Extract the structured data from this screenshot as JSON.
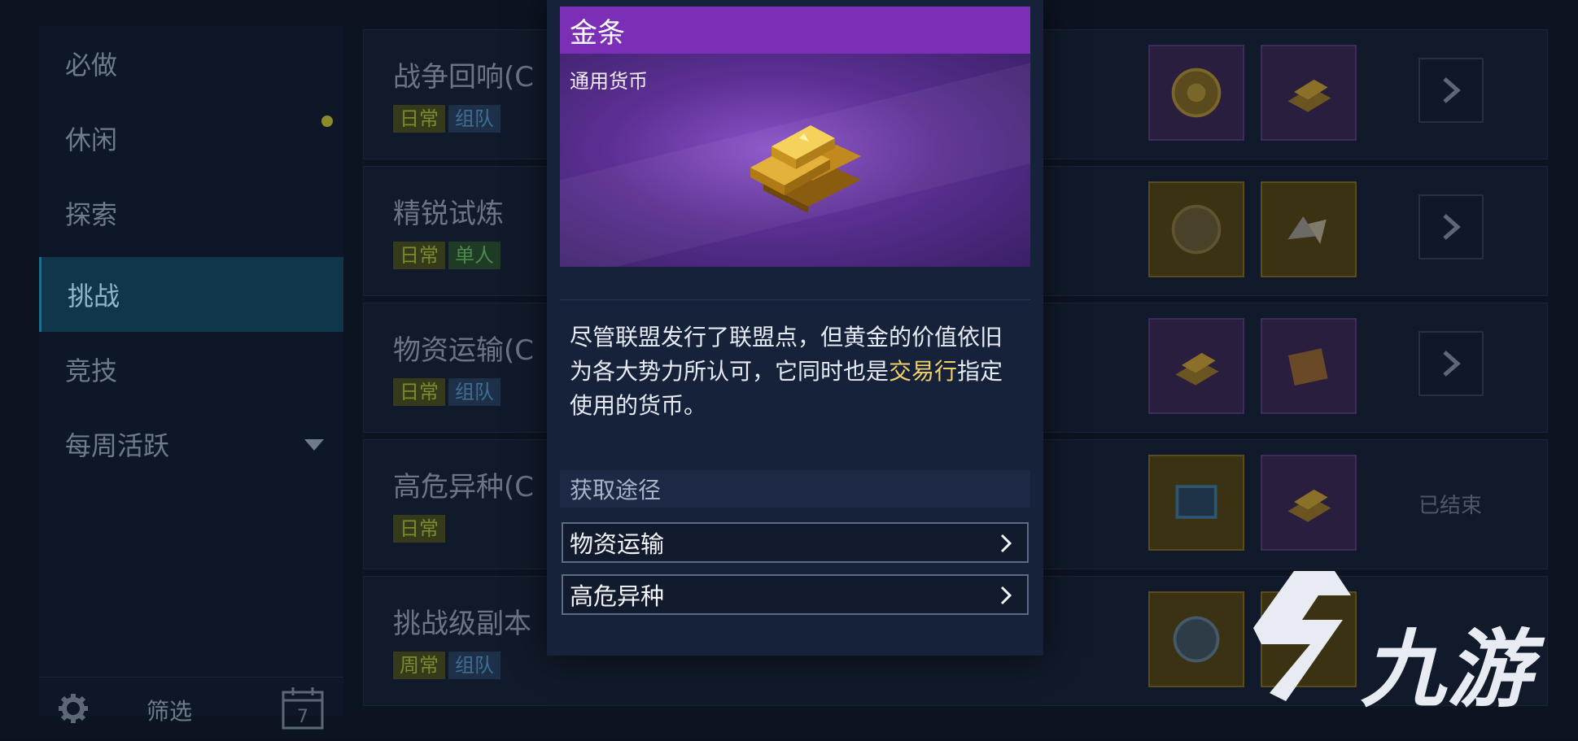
{
  "sidebar": {
    "items": [
      {
        "label": "必做"
      },
      {
        "label": "休闲"
      },
      {
        "label": "探索"
      },
      {
        "label": "挑战"
      },
      {
        "label": "竞技"
      },
      {
        "label": "每周活跃"
      }
    ],
    "active_index": 3,
    "filter_label": "筛选",
    "calendar_day": "7"
  },
  "activities": [
    {
      "title": "战争回响(C",
      "tags": [
        "日常",
        "组队"
      ],
      "action": "go"
    },
    {
      "title": "精锐试炼",
      "tags": [
        "日常",
        "单人"
      ],
      "action": "go"
    },
    {
      "title": "物资运输(C",
      "tags": [
        "日常",
        "组队"
      ],
      "action": "go"
    },
    {
      "title": "高危异种(C",
      "tags": [
        "日常"
      ],
      "action": "ended",
      "status": "已结束"
    },
    {
      "title": "挑战级副本",
      "tags": [
        "周常",
        "组队"
      ],
      "action": "none"
    }
  ],
  "popup": {
    "item_name": "金条",
    "item_type": "通用货币",
    "description_part1": "尽管联盟发行了联盟点，但黄金的价值依旧为各大势力所认可，它同时也是",
    "description_highlight": "交易行",
    "description_part2": "指定使用的货币。",
    "obtain_header": "获取途径",
    "obtain_sources": [
      {
        "label": "物资运输"
      },
      {
        "label": "高危异种"
      }
    ],
    "header_color": "#7b2fb6",
    "highlight_color": "#f2d06a"
  },
  "watermark": {
    "text": "九游"
  }
}
